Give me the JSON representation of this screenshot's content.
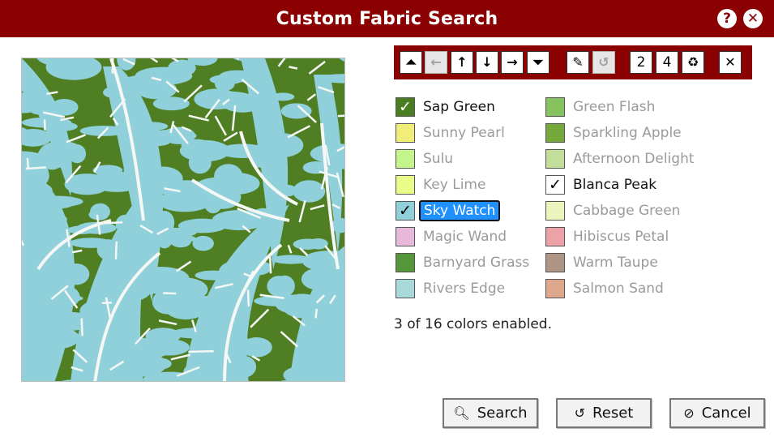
{
  "window": {
    "title": "Custom Fabric Search",
    "help_icon": "question-mark-icon",
    "close_icon": "close-x-icon"
  },
  "preview": {
    "colors": {
      "background": "#8fd0da",
      "pattern": "#4f7f22",
      "highlight": "#f5f7f4"
    }
  },
  "toolbar": {
    "buttons": [
      {
        "name": "move-to-top-button",
        "icon": "double-chevron-up-icon",
        "glyph": "⏶",
        "enabled": true
      },
      {
        "name": "back-button",
        "icon": "arrow-left-icon",
        "glyph": "←",
        "enabled": false
      },
      {
        "name": "move-up-button",
        "icon": "arrow-up-icon",
        "glyph": "↑",
        "enabled": true
      },
      {
        "name": "move-down-button",
        "icon": "arrow-down-icon",
        "glyph": "↓",
        "enabled": true
      },
      {
        "name": "forward-button",
        "icon": "arrow-right-icon",
        "glyph": "→",
        "enabled": true
      },
      {
        "name": "move-to-bottom-button",
        "icon": "double-chevron-down-icon",
        "glyph": "⏷",
        "enabled": true
      },
      {
        "name": "edit-button",
        "icon": "pencil-icon",
        "glyph": "✎",
        "enabled": true
      },
      {
        "name": "undo-button",
        "icon": "undo-icon",
        "glyph": "↺",
        "enabled": false
      },
      {
        "name": "two-button",
        "icon": "",
        "label": "2",
        "enabled": true
      },
      {
        "name": "four-button",
        "icon": "",
        "label": "4",
        "enabled": true
      },
      {
        "name": "recycle-button",
        "icon": "recycle-icon",
        "glyph": "♻",
        "enabled": true
      },
      {
        "name": "clear-button",
        "icon": "close-x-icon",
        "glyph": "✕",
        "enabled": true
      }
    ]
  },
  "colors": [
    {
      "name": "Sap Green",
      "swatch": "#4a7d22",
      "checked": true,
      "focused": false
    },
    {
      "name": "Sunny Pearl",
      "swatch": "#f1ed78",
      "checked": false,
      "focused": false
    },
    {
      "name": "Sulu",
      "swatch": "#c4f58a",
      "checked": false,
      "focused": false
    },
    {
      "name": "Key Lime",
      "swatch": "#eafc88",
      "checked": false,
      "focused": false
    },
    {
      "name": "Sky Watch",
      "swatch": "#8fd0da",
      "checked": true,
      "focused": true
    },
    {
      "name": "Magic Wand",
      "swatch": "#e6b8dc",
      "checked": false,
      "focused": false
    },
    {
      "name": "Barnyard Grass",
      "swatch": "#55983a",
      "checked": false,
      "focused": false
    },
    {
      "name": "Rivers Edge",
      "swatch": "#a8dada",
      "checked": false,
      "focused": false
    },
    {
      "name": "Green Flash",
      "swatch": "#86c25e",
      "checked": false,
      "focused": false
    },
    {
      "name": "Sparkling Apple",
      "swatch": "#75a93b",
      "checked": false,
      "focused": false
    },
    {
      "name": "Afternoon Delight",
      "swatch": "#c2de9a",
      "checked": false,
      "focused": false
    },
    {
      "name": "Blanca Peak",
      "swatch": "#ffffff",
      "checked": true,
      "focused": false
    },
    {
      "name": "Cabbage Green",
      "swatch": "#ecf3bd",
      "checked": false,
      "focused": false
    },
    {
      "name": "Hibiscus Petal",
      "swatch": "#eca2a6",
      "checked": false,
      "focused": false
    },
    {
      "name": "Warm Taupe",
      "swatch": "#ae9585",
      "checked": false,
      "focused": false
    },
    {
      "name": "Salmon Sand",
      "swatch": "#dfa78c",
      "checked": false,
      "focused": false
    }
  ],
  "status": "3 of 16 colors enabled.",
  "actions": {
    "search": {
      "label": "Search",
      "icon": "magnifier-icon"
    },
    "reset": {
      "label": "Reset",
      "icon": "undo-icon"
    },
    "cancel": {
      "label": "Cancel",
      "icon": "no-entry-icon"
    }
  }
}
